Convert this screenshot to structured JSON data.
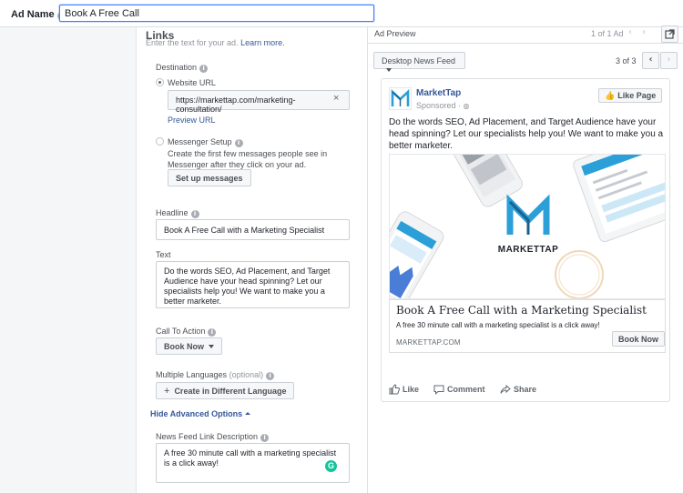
{
  "top": {
    "ad_name_label": "Ad Name",
    "ad_name_value": "Book A Free Call"
  },
  "editor": {
    "section_title": "Links",
    "section_sub": "Enter the text for your ad.",
    "learn_more": "Learn more.",
    "destination_label": "Destination",
    "website_url_label": "Website URL",
    "website_url_value": "https://markettap.com/marketing-consultation/",
    "preview_url": "Preview URL",
    "messenger_label": "Messenger Setup",
    "messenger_desc": "Create the first few messages people see in Messenger after they click on your ad.",
    "setup_messages": "Set up messages",
    "headline_label": "Headline",
    "headline_value": "Book A Free Call with a Marketing Specialist",
    "text_label": "Text",
    "text_value": "Do the words SEO, Ad Placement, and Target Audience have your head spinning? Let our specialists help you! We want to make you a better marketer.",
    "cta_label": "Call To Action",
    "cta_value": "Book Now",
    "languages_label": "Multiple Languages",
    "languages_optional": "(optional)",
    "create_language": "Create in Different Language",
    "hide_advanced": "Hide Advanced Options",
    "news_feed_desc_label": "News Feed Link Description",
    "news_feed_desc_value": "A free 30 minute call with a marketing specialist is a click away!"
  },
  "preview": {
    "title": "Ad Preview",
    "ad_count": "1 of 1 Ad",
    "placement": "Desktop News Feed",
    "page_counter": "3 of 3"
  },
  "ad": {
    "page_name": "MarketTap",
    "sponsored": "Sponsored",
    "like_page": "Like Page",
    "body": "Do the words SEO, Ad Placement, and Target Audience have your head spinning? Let our specialists help you! We want to make you a better marketer.",
    "brand_wordmark": "MARKETTAP",
    "headline": "Book A Free Call with a Marketing Specialist",
    "link_desc": "A free 30 minute call with a marketing specialist is a click away!",
    "domain": "MARKETTAP.COM",
    "cta": "Book Now",
    "like": "Like",
    "comment": "Comment",
    "share": "Share"
  },
  "colors": {
    "accent": "#4080ff",
    "link": "#365899",
    "brand_blue": "#2a9fd8",
    "brand_dark": "#1b5f8c"
  }
}
